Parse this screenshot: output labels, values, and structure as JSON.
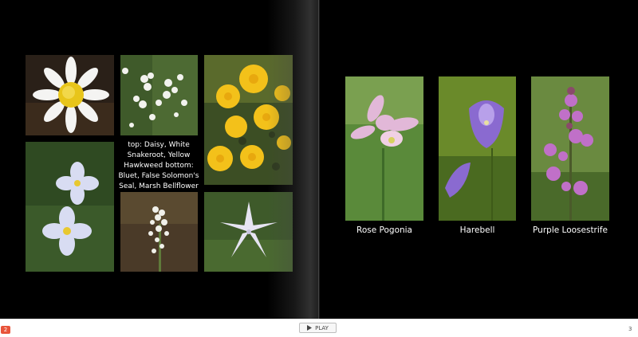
{
  "left_page": {
    "caption": "top: Daisy, White Snakeroot, Yellow Hawkweed bottom: Bluet, False Solomon's Seal, Marsh Bellflower"
  },
  "right_page": {
    "captions": [
      "Rose Pogonia",
      "Harebell",
      "Purple Loosestrife"
    ]
  },
  "footer": {
    "left_badge": "2",
    "play_label": "PLAY",
    "page_number": "3"
  }
}
